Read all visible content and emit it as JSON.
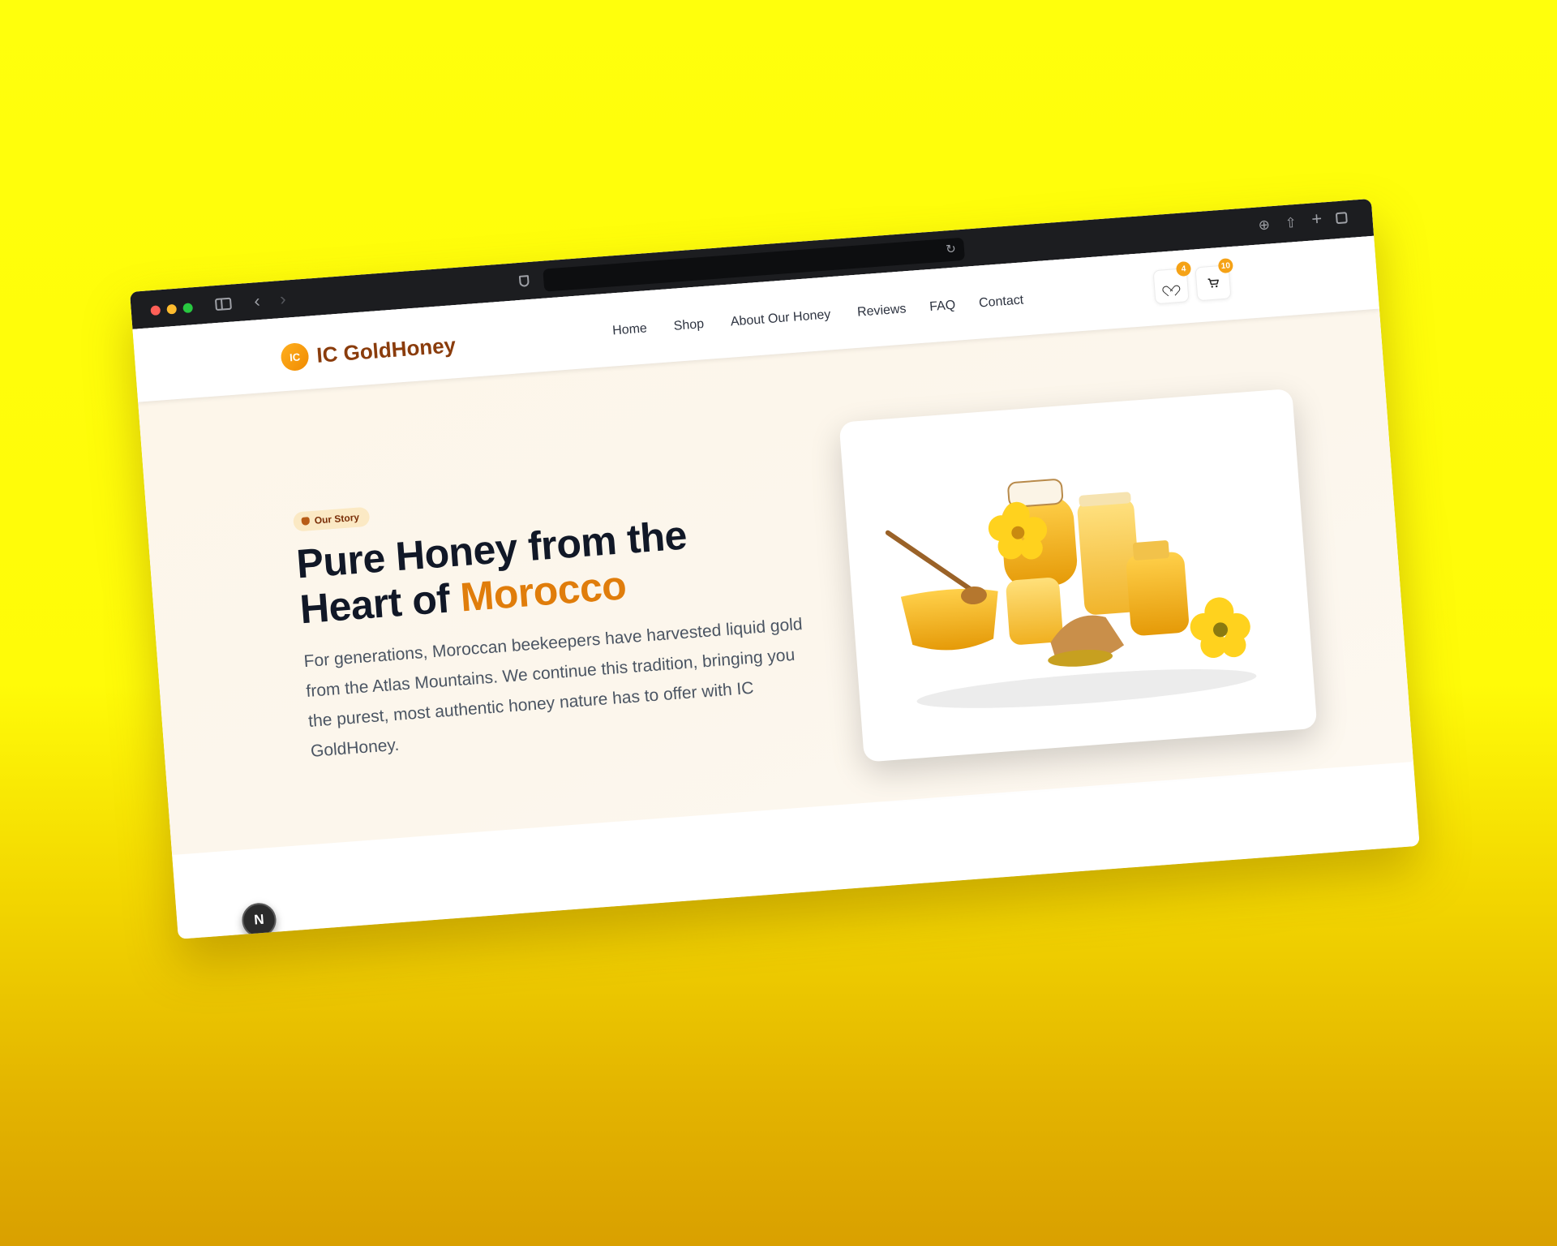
{
  "browser": {
    "address_text": ""
  },
  "site": {
    "logo_initials": "IC",
    "logo_text": "IC GoldHoney"
  },
  "nav": {
    "links": [
      "Home",
      "Shop",
      "About Our Honey",
      "Reviews",
      "FAQ",
      "Contact"
    ]
  },
  "header_actions": {
    "wishlist_count": "4",
    "cart_count": "10"
  },
  "hero": {
    "badge": "Our Story",
    "title_line1": "Pure Honey from the",
    "title_line2_prefix": "Heart of",
    "title_accent": "Morocco",
    "description": "For generations, Moroccan beekeepers have harvested liquid gold from the Atlas Mountains. We continue this tradition, bringing you the purest, most authentic honey nature has to offer with IC GoldHoney."
  },
  "dev_badge": "N",
  "colors": {
    "accent": "#e07d0b",
    "brand_text": "#8a3c0c",
    "badge": "#f5a216",
    "hero_bg": "#fcf6ec"
  },
  "icons": [
    "sidebar-icon",
    "back-icon",
    "forward-icon",
    "shield-icon",
    "reload-icon",
    "download-icon",
    "share-icon",
    "new-tab-icon",
    "tabs-icon",
    "heart-icon",
    "cart-icon"
  ]
}
